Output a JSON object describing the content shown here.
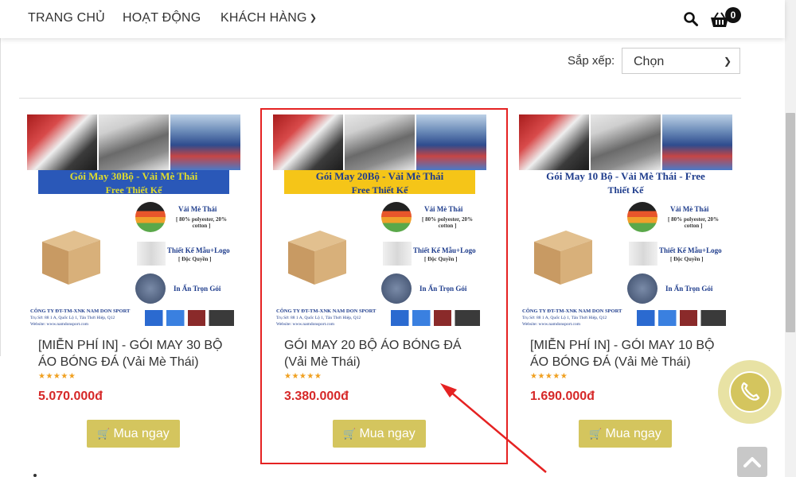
{
  "nav": {
    "home_label": "TRANG CHỦ",
    "activity_label": "HOẠT ĐỘNG",
    "customers_label": "KHÁCH HÀNG",
    "cart_count": "0"
  },
  "sort": {
    "label": "Sắp xếp:",
    "selected": "Chọn"
  },
  "products": [
    {
      "name": "[MIỄN PHÍ IN] - GÓI MAY 30 BỘ ÁO BÓNG ĐÁ (Vải Mè Thái)",
      "rating_stars": 5,
      "price": "5.070.000đ",
      "buy_label": "Mua ngay",
      "image": {
        "banner_title": "Gói May 30Bộ - Vải Mè Thái",
        "banner_sub": "Free Thiết Kế"
      }
    },
    {
      "name": "GÓI MAY 20 BỘ ÁO BÓNG ĐÁ (Vải Mè Thái)",
      "rating_stars": 5,
      "price": "3.380.000đ",
      "buy_label": "Mua ngay",
      "image": {
        "banner_title": "Gói May 20Bộ - Vải Mè Thái",
        "banner_sub": "Free Thiết Kế"
      }
    },
    {
      "name": "[MIỄN PHÍ IN] - GÓI MAY 10 BỘ ÁO BÓNG ĐÁ (Vải Mè Thái)",
      "rating_stars": 5,
      "price": "1.690.000đ",
      "buy_label": "Mua ngay",
      "image": {
        "banner_title": "Gói May 10 Bộ - Vải Mè Thái -  Free",
        "banner_sub": "Thiết Kế"
      }
    }
  ],
  "image_common": {
    "feature_1_title": "Vải Mè Thái",
    "feature_1_sub": "[ 80% polyester, 20% cotton ]",
    "feature_2_title": "Thiết Kế Mẫu+Logo",
    "feature_2_sub": "[ Độc Quyền ]",
    "feature_3_title": "In Ấn Trọn Gói",
    "company": "CÔNG TY ĐT-TM-XNK NAM DON SPORT",
    "address": "Trụ Sở: 88 1 A, Quốc Lộ 1, Tân Thới Hiệp, Q12",
    "website": "Website: www.namdonsport.com"
  },
  "colors": {
    "price": "#d62828",
    "button": "#d4c55e",
    "highlight": "#e52222",
    "star": "#f0a020"
  },
  "icons": {
    "search": "search-icon",
    "cart": "cart-icon",
    "phone": "phone-icon",
    "scroll_top": "chevron-up-icon"
  }
}
